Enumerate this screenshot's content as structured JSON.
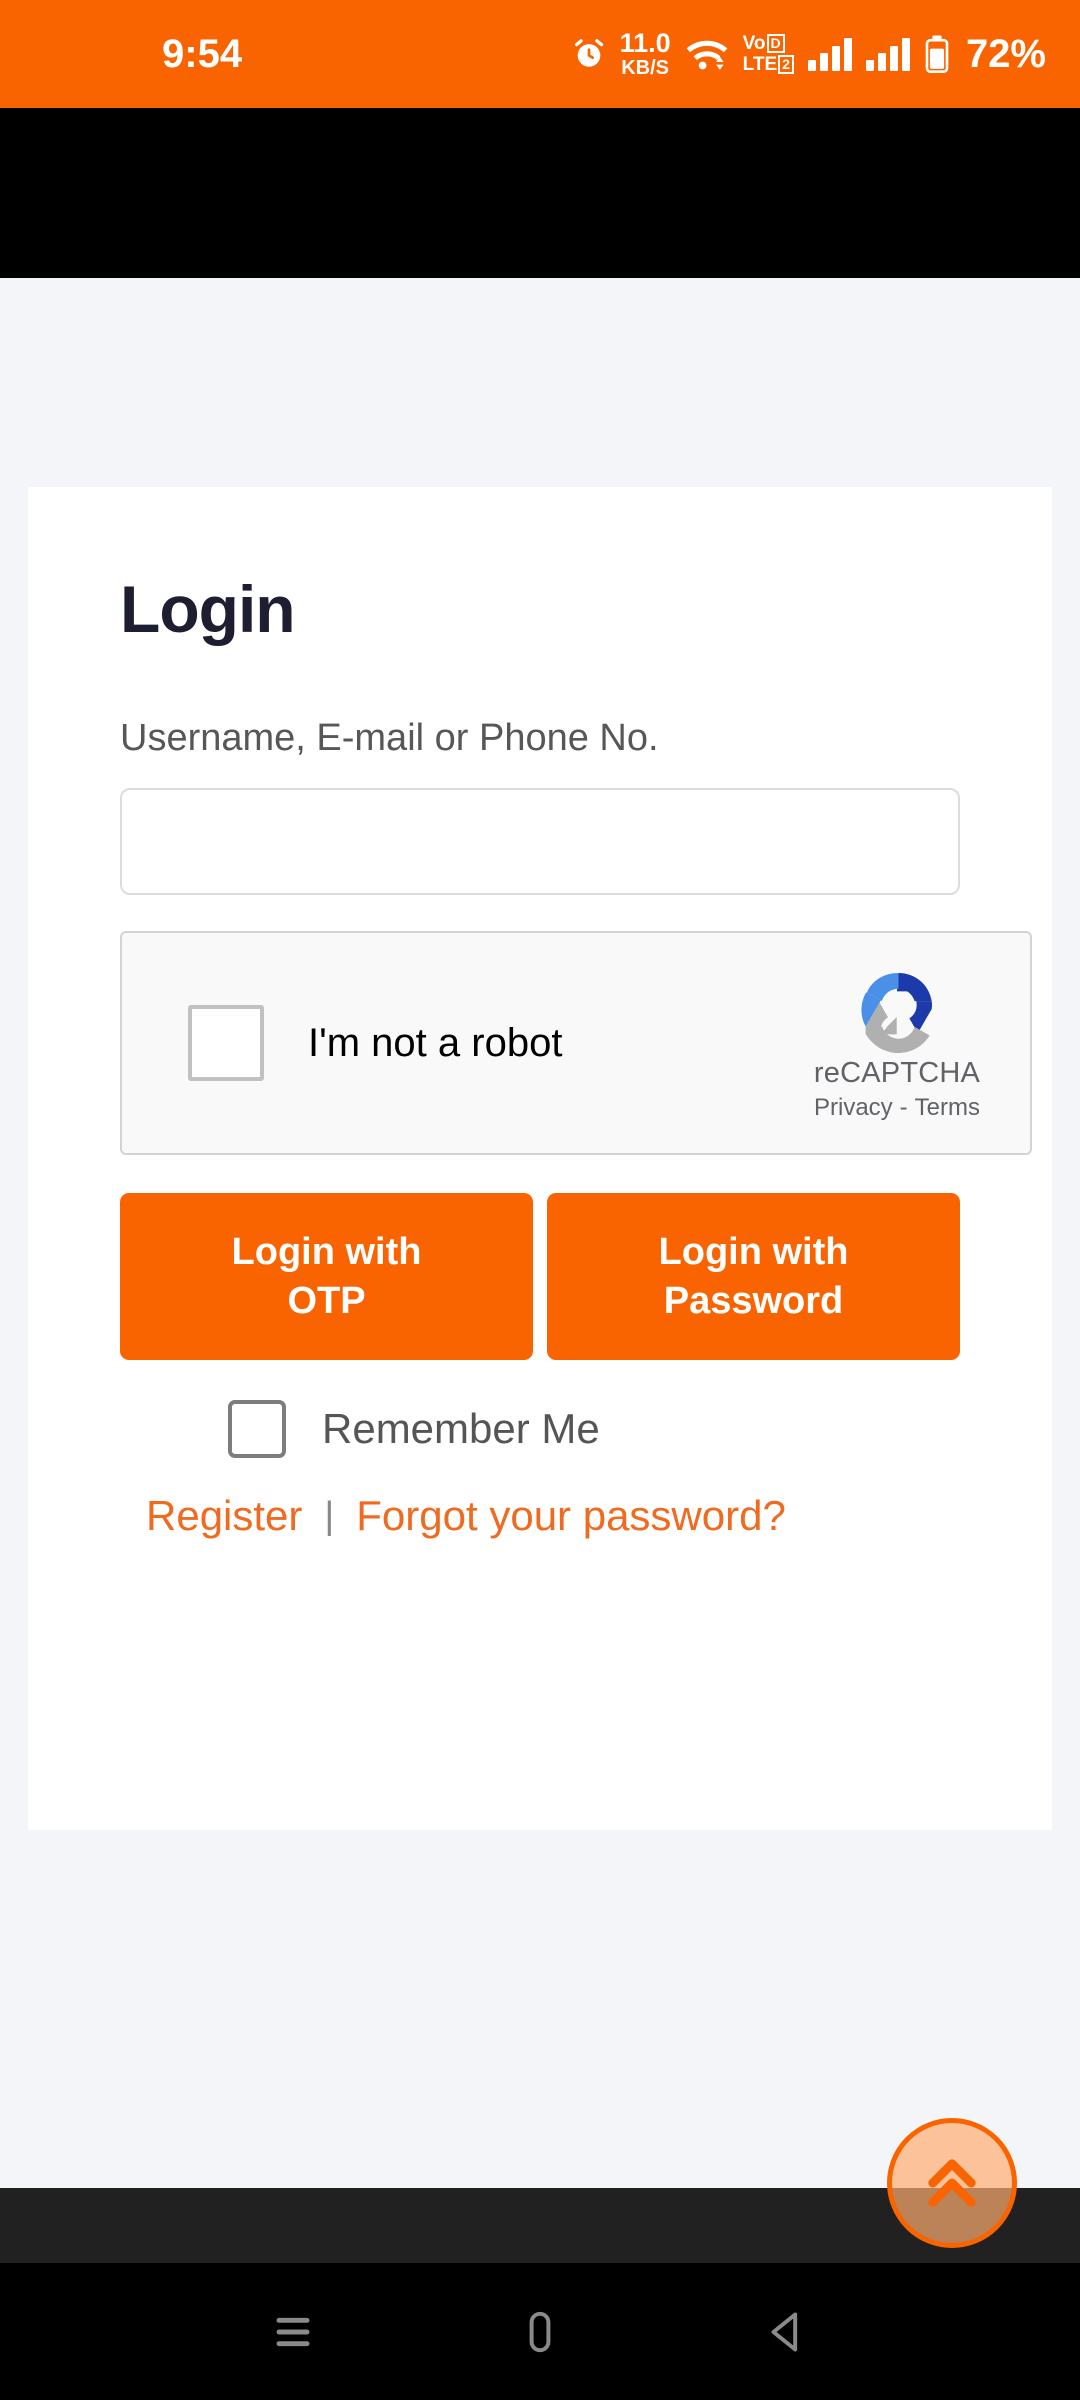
{
  "status_bar": {
    "clock": "9:54",
    "alarm_icon": "alarm-clock-icon",
    "net_speed_value": "11.0",
    "net_speed_unit": "KB/S",
    "wifi_icon": "wifi-icon",
    "volte_line1": "Vo",
    "volte_line1_badge": "D",
    "volte_line2": "LTE",
    "volte_line2_badge": "2",
    "signal_icon_1": "signal-bars-sim1-icon",
    "signal_icon_2": "signal-bars-sim2-icon",
    "battery_icon": "battery-icon",
    "battery_percent": "72%",
    "background_color": "#fa6400"
  },
  "header": {
    "background_color": "#000000"
  },
  "card": {
    "title": "Login",
    "username": {
      "label": "Username, E-mail or Phone No.",
      "value": "",
      "placeholder": ""
    },
    "recaptcha": {
      "label": "I'm not a robot",
      "checked": false,
      "brand": "reCAPTCHA",
      "privacy": "Privacy",
      "separator": "-",
      "terms": "Terms",
      "logo_icon": "recaptcha-logo-icon",
      "logo_colors": {
        "light_blue": "#4a90e8",
        "dark_blue": "#1c3aa9",
        "gray": "#b0b0b0"
      }
    },
    "buttons": [
      {
        "label": "Login with\nOTP",
        "name": "login-with-otp-button"
      },
      {
        "label": "Login with\nPassword",
        "name": "login-with-password-button"
      }
    ],
    "remember_me": {
      "label": "Remember Me",
      "checked": false
    },
    "links": {
      "register": "Register",
      "separator": "|",
      "forgot_password": "Forgot your password?"
    },
    "accent_color": "#f96400",
    "link_color": "#f06a20",
    "title_color": "#1e1e32"
  },
  "scroll_top": {
    "icon": "double-chevron-up-icon",
    "border_color": "#f96400"
  },
  "nav_bar": {
    "recents_icon": "recents-icon",
    "home_icon": "home-icon",
    "back_icon": "back-icon",
    "background_color": "#000000"
  },
  "page": {
    "background_color": "#f4f5f8"
  }
}
